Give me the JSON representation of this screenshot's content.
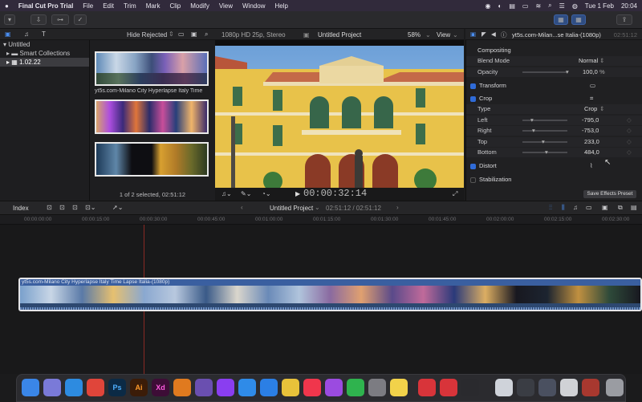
{
  "menubar": {
    "app": "Final Cut Pro Trial",
    "items": [
      "File",
      "Edit",
      "Trim",
      "Mark",
      "Clip",
      "Modify",
      "View",
      "Window",
      "Help"
    ],
    "date": "Tue 1 Feb",
    "time": "20:04"
  },
  "library": {
    "items": [
      {
        "label": "Untitled"
      },
      {
        "label": "Smart Collections"
      },
      {
        "label": "1.02.22"
      }
    ]
  },
  "browser": {
    "filter": "Hide Rejected",
    "clip_title": "yt5s.com-Milano City Hyperlapse Italy Time",
    "status": "1 of 2 selected, 02:51:12"
  },
  "viewer": {
    "format": "1080p HD 25p, Stereo",
    "project": "Untitled Project",
    "zoom": "58%",
    "view": "View",
    "timecode": "00:00:32:14"
  },
  "inspector": {
    "clip_name": "yt5s.com-Milan...se Italia-(1080p)",
    "duration": "02:51:12",
    "compositing": "Compositing",
    "blend_label": "Blend Mode",
    "blend_value": "Normal",
    "opacity_label": "Opacity",
    "opacity_value": "100,0",
    "opacity_unit": "%",
    "transform": "Transform",
    "crop": "Crop",
    "type_label": "Type",
    "type_value": "Crop",
    "left_label": "Left",
    "left_value": "-795,0",
    "right_label": "Right",
    "right_value": "-753,0",
    "top_label": "Top",
    "top_value": "233,0",
    "bottom_label": "Bottom",
    "bottom_value": "484,0",
    "distort": "Distort",
    "stabilization": "Stabilization",
    "save_preset": "Save Effects Preset"
  },
  "timeline": {
    "index": "Index",
    "project": "Untitled Project",
    "duration": "02:51:12 / 02:51:12",
    "clip_label": "yt5s.com-Milano City Hyperlapse Italy Time Lapse Italia-(1080p)",
    "ruler": [
      "00:00:00:00",
      "00:00:15:00",
      "00:00:30:00",
      "00:00:45:00",
      "00:01:00:00",
      "00:01:15:00",
      "00:01:30:00",
      "00:01:45:00",
      "00:02:00:00",
      "00:02:15:00",
      "00:02:30:00"
    ]
  },
  "dock": {
    "apps": [
      {
        "name": "Finder",
        "glyph": "",
        "color": "#3a86e8"
      },
      {
        "name": "Launchpad",
        "glyph": "",
        "color": "#7a7ad8"
      },
      {
        "name": "Safari",
        "glyph": "",
        "color": "#2d8be0"
      },
      {
        "name": "Chrome",
        "glyph": "",
        "color": "#e0453a"
      },
      {
        "name": "Photoshop",
        "glyph": "Ps",
        "color": "#0b2a45"
      },
      {
        "name": "Illustrator",
        "glyph": "Ai",
        "color": "#3b1c08"
      },
      {
        "name": "XD",
        "glyph": "Xd",
        "color": "#3d0d36"
      },
      {
        "name": "Blender",
        "glyph": "",
        "color": "#e07a1f"
      },
      {
        "name": "Pencil",
        "glyph": "",
        "color": "#6a4fb0"
      },
      {
        "name": "Messenger",
        "glyph": "",
        "color": "#8a3ef0"
      },
      {
        "name": "Mail",
        "glyph": "",
        "color": "#2f8be8"
      },
      {
        "name": "App Store",
        "glyph": "",
        "color": "#2b7fe5"
      },
      {
        "name": "Photos",
        "glyph": "",
        "color": "#e8c23a"
      },
      {
        "name": "Music",
        "glyph": "",
        "color": "#f0364c"
      },
      {
        "name": "Podcasts",
        "glyph": "",
        "color": "#9b4be0"
      },
      {
        "name": "Numbers",
        "glyph": "",
        "color": "#2fb34e"
      },
      {
        "name": "System Preferences",
        "glyph": "",
        "color": "#7c7c82"
      },
      {
        "name": "Notes",
        "glyph": "",
        "color": "#f2d24a"
      },
      {
        "name": "App A",
        "glyph": "",
        "color": "#d8343a"
      },
      {
        "name": "App B",
        "glyph": "",
        "color": "#d8343a"
      },
      {
        "name": "Final Cut Pro",
        "glyph": "",
        "color": "#2a2a2e"
      },
      {
        "name": "Preview",
        "glyph": "",
        "color": "#cfd3da"
      },
      {
        "name": "Window 1",
        "glyph": "",
        "color": "#3a3d44"
      },
      {
        "name": "Window 2",
        "glyph": "",
        "color": "#4a5060"
      },
      {
        "name": "Window 3",
        "glyph": "",
        "color": "#d0d2d6"
      },
      {
        "name": "Window 4",
        "glyph": "",
        "color": "#a8382f"
      },
      {
        "name": "Trash",
        "glyph": "",
        "color": "#9a9ca2"
      }
    ]
  }
}
